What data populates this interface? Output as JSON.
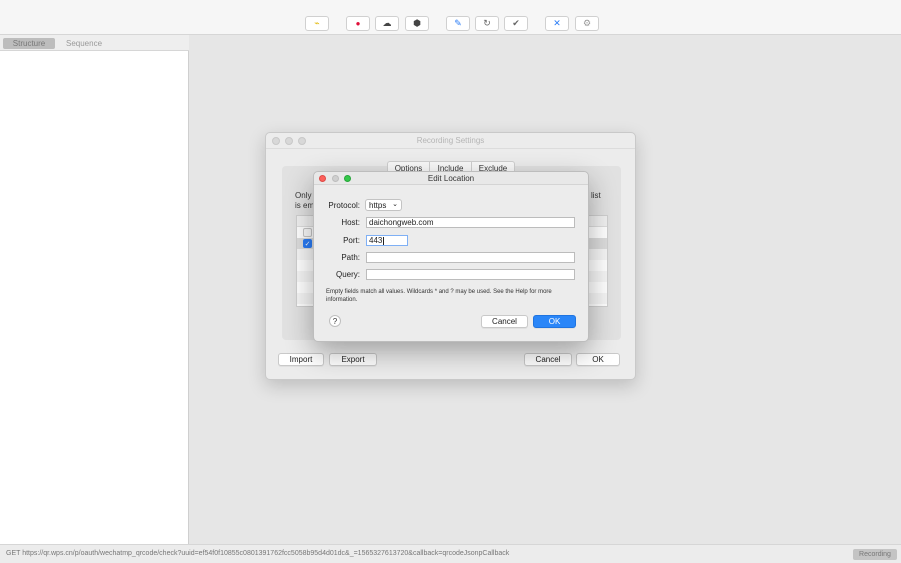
{
  "toolbar": {
    "buttons": [
      {
        "name": "broom-icon",
        "glyph": "⌁",
        "color": "#e2b90b"
      },
      {
        "name": "record-icon",
        "glyph": "●",
        "color": "#e0103a"
      },
      {
        "name": "turtle-icon",
        "glyph": "☁",
        "color": "#444444"
      },
      {
        "name": "breakpoint-icon",
        "glyph": "⬢",
        "color": "#444444"
      },
      {
        "name": "pen-icon",
        "glyph": "✎",
        "color": "#2a7cf6"
      },
      {
        "name": "refresh-icon",
        "glyph": "↻",
        "color": "#666666"
      },
      {
        "name": "check-icon",
        "glyph": "✔",
        "color": "#666666"
      },
      {
        "name": "tools-icon",
        "glyph": "✕",
        "color": "#2a7cf6"
      },
      {
        "name": "settings-icon",
        "glyph": "⚙",
        "color": "#999999"
      }
    ]
  },
  "sidebar": {
    "tabs": [
      {
        "label": "Structure",
        "active": true
      },
      {
        "label": "Sequence",
        "active": false
      }
    ]
  },
  "status": {
    "text": "GET https://qr.wps.cn/p/oauth/wechatmp_qrcode/check?uuid=ef54f0f10855c0801391762fcc5058b95d4d01dc&_=1565327613720&callback=qrcodeJsonpCallback",
    "badge": "Recording"
  },
  "recording_settings": {
    "title": "Recording Settings",
    "tabs": [
      "Options",
      "Include",
      "Exclude"
    ],
    "desc_line1_left": "Only",
    "desc_line1_right": "list",
    "desc_line2_left": "is em",
    "rows": [
      {
        "checked": false
      },
      {
        "checked": true
      }
    ],
    "buttons": {
      "import": "Import",
      "export": "Export",
      "cancel": "Cancel",
      "ok": "OK"
    }
  },
  "edit_location": {
    "title": "Edit Location",
    "protocol_label": "Protocol:",
    "protocol_value": "https",
    "host_label": "Host:",
    "host_value": "daichongweb.com",
    "port_label": "Port:",
    "port_value": "443",
    "path_label": "Path:",
    "path_value": "",
    "query_label": "Query:",
    "query_value": "",
    "help_text": "Empty fields match all values. Wildcards * and ? may be used. See the Help for more information.",
    "help_button": "?",
    "cancel": "Cancel",
    "ok": "OK"
  },
  "colors": {
    "accent": "#2a86f8",
    "close": "#fc605b",
    "minimize": "#fdbc40",
    "zoom": "#34c84a"
  }
}
